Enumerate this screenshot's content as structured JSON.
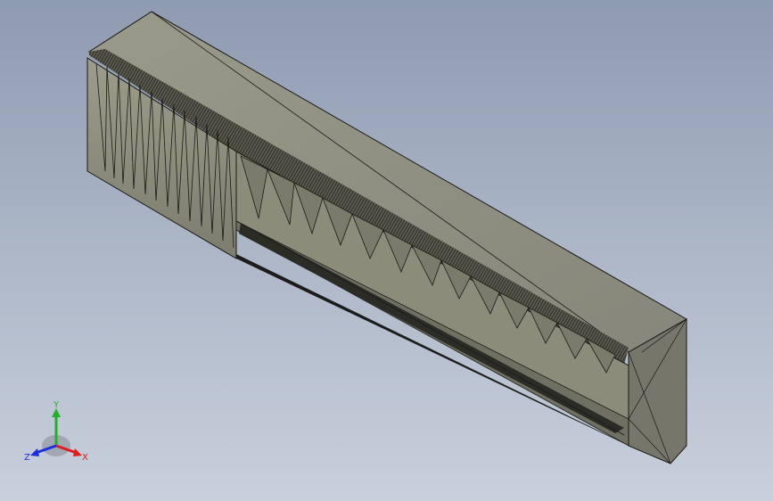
{
  "viewport": {
    "model": "3d-part-isometric"
  },
  "triad": {
    "x_label": "X",
    "y_label": "Y",
    "z_label": "Z",
    "x_color": "#e01c1c",
    "y_color": "#22b02a",
    "z_color": "#1c2fe0"
  },
  "colors": {
    "face_top": "#8f8f80",
    "face_front": "#8a8a79",
    "face_end": "#77776a",
    "face_dark": "#4d4d44",
    "edge": "#1a1a18"
  }
}
